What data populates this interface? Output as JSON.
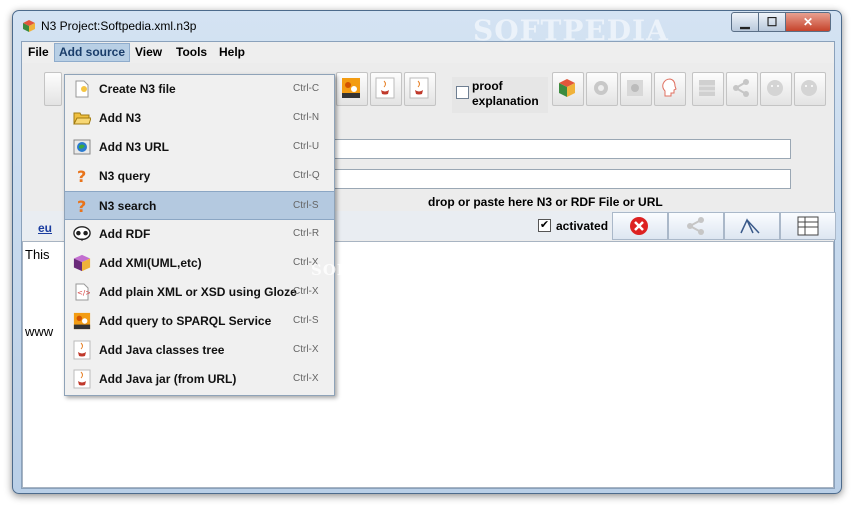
{
  "window": {
    "title": "N3 Project:Softpedia.xml.n3p",
    "watermark": "SOFTPEDIA"
  },
  "menubar": {
    "items": [
      "File",
      "Add source",
      "View",
      "Tools",
      "Help"
    ],
    "active": "Add source"
  },
  "toolbar": {
    "proof_label": "proof\nexplanation",
    "proof_checked": false,
    "icons": [
      "sparql-icon",
      "java-icon",
      "java-icon",
      "cube-icon",
      "gear-icon",
      "network-icon",
      "head-icon",
      "grid-icon",
      "share-icon",
      "smiley-icon",
      "smiley-icon"
    ]
  },
  "drop_hint": "drop or paste here N3 or RDF File or URL",
  "status": {
    "link_text": "eu",
    "activated_label": "activated",
    "activated_checked": true
  },
  "content": {
    "line1": "This",
    "line2": "www"
  },
  "add_source_menu": {
    "highlighted_index": 4,
    "items": [
      {
        "label": "Create N3 file",
        "shortcut": "Ctrl-C",
        "icon": "new-file-icon"
      },
      {
        "label": "Add N3",
        "shortcut": "Ctrl-N",
        "icon": "open-folder-icon"
      },
      {
        "label": "Add N3 URL",
        "shortcut": "Ctrl-U",
        "icon": "globe-icon"
      },
      {
        "label": "N3 query",
        "shortcut": "Ctrl-Q",
        "icon": "question-icon"
      },
      {
        "label": "N3 search",
        "shortcut": "Ctrl-S",
        "icon": "question-icon"
      },
      {
        "label": "Add RDF",
        "shortcut": "Ctrl-R",
        "icon": "rdf-icon"
      },
      {
        "label": "Add XMI(UML,etc)",
        "shortcut": "Ctrl-X",
        "icon": "xmi-icon"
      },
      {
        "label": "Add plain XML or XSD using Gloze",
        "shortcut": "Ctrl-X",
        "icon": "xml-icon"
      },
      {
        "label": "Add query to SPARQL Service",
        "shortcut": "Ctrl-S",
        "icon": "sparql-icon"
      },
      {
        "label": "Add Java classes tree",
        "shortcut": "Ctrl-X",
        "icon": "java-icon"
      },
      {
        "label": "Add Java jar (from URL)",
        "shortcut": "Ctrl-X",
        "icon": "java-icon"
      }
    ]
  },
  "colors": {
    "menu_highlight": "#b4c9e0",
    "title_gradient_top": "#d4e3f3",
    "close_button": "#c6432b",
    "link": "#1a3da0"
  }
}
